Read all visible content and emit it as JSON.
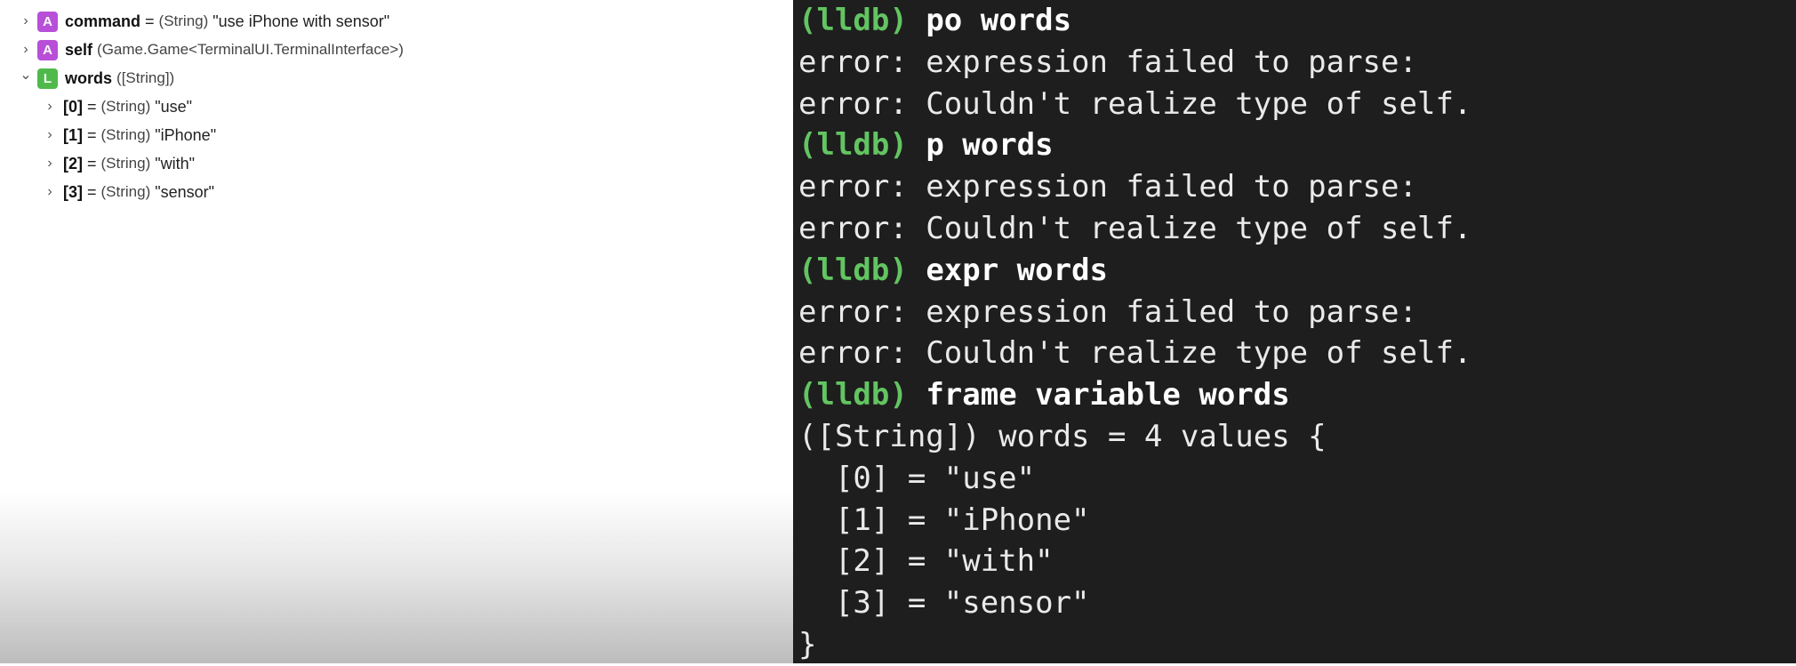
{
  "variables": {
    "top": [
      {
        "name": "command",
        "sep": " = ",
        "type": "(String)",
        "value": " \"use iPhone with sensor\"",
        "badge": "A",
        "badge_color": "#b84fd8",
        "expanded": false
      },
      {
        "name": "self",
        "sep": " ",
        "type": "(Game.Game<TerminalUI.TerminalInterface>)",
        "value": "",
        "badge": "A",
        "badge_color": "#b84fd8",
        "expanded": false
      },
      {
        "name": "words",
        "sep": " ",
        "type": "([String])",
        "value": "",
        "badge": "L",
        "badge_color": "#4fba4b",
        "expanded": true
      }
    ],
    "children": [
      {
        "name": "[0]",
        "sep": " = ",
        "type": "(String)",
        "value": " \"use\""
      },
      {
        "name": "[1]",
        "sep": " = ",
        "type": "(String)",
        "value": " \"iPhone\""
      },
      {
        "name": "[2]",
        "sep": " = ",
        "type": "(String)",
        "value": " \"with\""
      },
      {
        "name": "[3]",
        "sep": " = ",
        "type": "(String)",
        "value": " \"sensor\""
      }
    ]
  },
  "console": {
    "prompt": "(lldb)",
    "lines": [
      {
        "kind": "cmd",
        "text": "po words"
      },
      {
        "kind": "out",
        "text": "error: expression failed to parse:"
      },
      {
        "kind": "out",
        "text": "error: Couldn't realize type of self."
      },
      {
        "kind": "cmd",
        "text": "p words"
      },
      {
        "kind": "out",
        "text": "error: expression failed to parse:"
      },
      {
        "kind": "out",
        "text": "error: Couldn't realize type of self."
      },
      {
        "kind": "cmd",
        "text": "expr words"
      },
      {
        "kind": "out",
        "text": "error: expression failed to parse:"
      },
      {
        "kind": "out",
        "text": "error: Couldn't realize type of self."
      },
      {
        "kind": "cmd",
        "text": "frame variable words"
      },
      {
        "kind": "out",
        "text": "([String]) words = 4 values {"
      },
      {
        "kind": "out",
        "text": "  [0] = \"use\""
      },
      {
        "kind": "out",
        "text": "  [1] = \"iPhone\""
      },
      {
        "kind": "out",
        "text": "  [2] = \"with\""
      },
      {
        "kind": "out",
        "text": "  [3] = \"sensor\""
      },
      {
        "kind": "out",
        "text": "}"
      }
    ]
  }
}
